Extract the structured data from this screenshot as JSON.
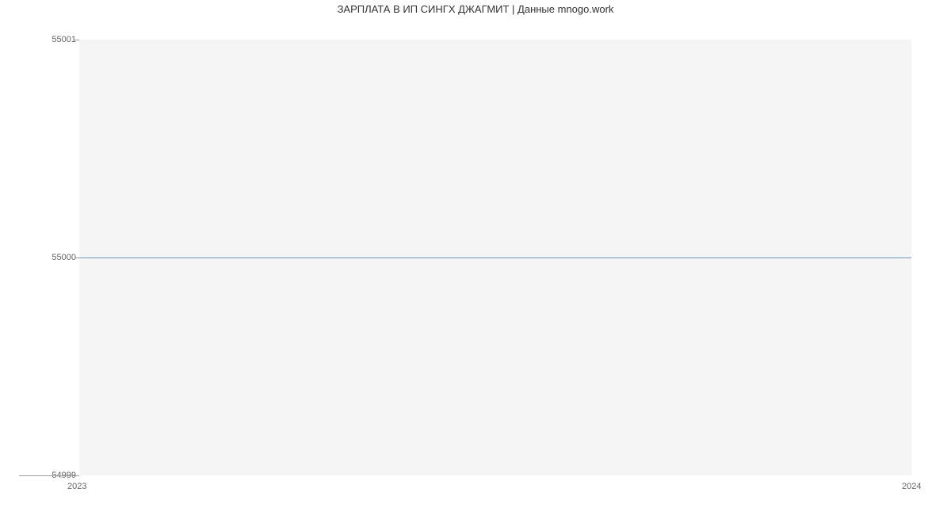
{
  "chart_data": {
    "type": "line",
    "title": "ЗАРПЛАТА В ИП СИНГХ ДЖАГМИТ | Данные mnogo.work",
    "x": [
      2023,
      2024
    ],
    "values": [
      55000,
      55000
    ],
    "xlabel": "",
    "ylabel": "",
    "ylim": [
      54999,
      55001
    ],
    "y_ticks": [
      54999,
      55000,
      55001
    ],
    "x_ticks": [
      2023,
      2024
    ],
    "colors": {
      "line": "#6c9bd1",
      "plot_bg": "#f5f5f5"
    }
  },
  "labels": {
    "y_55001": "55001",
    "y_55000": "55000",
    "y_54999": "54999",
    "x_2023": "2023",
    "x_2024": "2024"
  }
}
